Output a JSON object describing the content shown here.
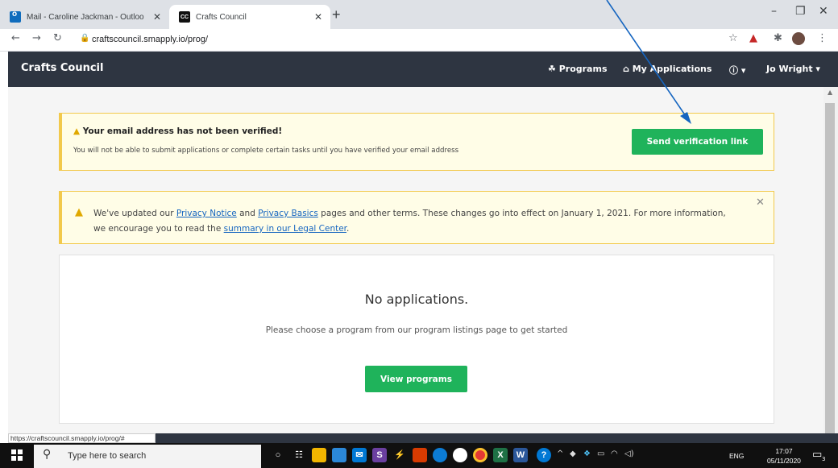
{
  "browser": {
    "tabs": [
      {
        "title": "Mail - Caroline Jackman - Outloo",
        "icon": "outlook-icon"
      },
      {
        "title": "Crafts Council",
        "icon": "crafts-council-icon",
        "icon_text": "CC",
        "active": true
      }
    ],
    "url": "craftscouncil.smapply.io/prog/",
    "status_url": "https://craftscouncil.smapply.io/prog/#"
  },
  "site": {
    "brand": "Crafts Council",
    "nav": {
      "programs": "Programs",
      "my_applications": "My Applications",
      "user": "Jo Wright"
    }
  },
  "alerts": {
    "email": {
      "title": "Your email address has not been verified!",
      "body": "You will not be able to submit applications or complete certain tasks until you have verified your email address",
      "button": "Send verification link"
    },
    "privacy": {
      "text1": "We've updated our ",
      "link1": "Privacy Notice",
      "text2": " and ",
      "link2": "Privacy Basics",
      "text3": " pages and other terms. These changes go into effect on January 1, 2021. For more information, we encourage you to read the ",
      "link3": "summary in our Legal Center",
      "text4": "."
    }
  },
  "main": {
    "empty_title": "No applications.",
    "empty_body": "Please choose a program from our program listings page to get started",
    "button": "View programs"
  },
  "taskbar": {
    "search_placeholder": "Type here to search",
    "language": "ENG",
    "time": "17:07",
    "date": "05/11/2020",
    "notification_count": "3"
  },
  "colors": {
    "accent_green": "#1fb35b",
    "nav_bg": "#2e3541",
    "alert_border": "#f2c94c",
    "annotation_arrow": "#1565c0"
  }
}
